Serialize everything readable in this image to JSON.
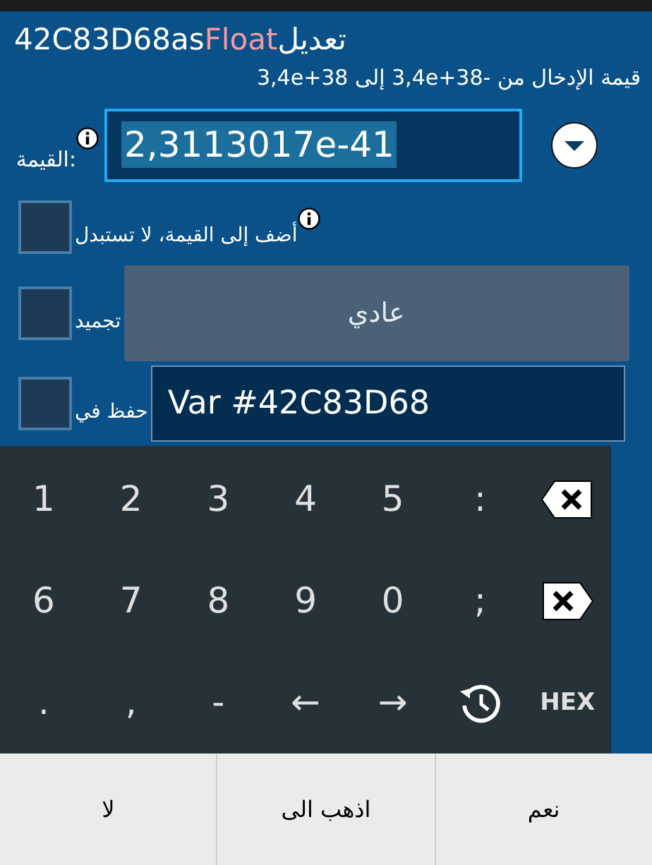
{
  "dialog": {
    "title": {
      "name": "42C83D68as",
      "type": "Float",
      "action": "تعديل"
    },
    "range": "قيمة الإدخال من -3,4e+38 إلى 3,4e+38",
    "value": {
      "label": "القيمة:",
      "text": "2,3113017e-41",
      "selected": true
    },
    "options": [
      {
        "kind": "plain",
        "label": "أضف إلى القيمة، لا تستبدل",
        "checked": false,
        "info": true
      },
      {
        "kind": "button",
        "label": "تجميد",
        "checked": false,
        "control": "عادي"
      },
      {
        "kind": "field",
        "label": "حفظ في",
        "checked": false,
        "control": "Var #42C83D68"
      }
    ]
  },
  "keyboard": [
    {
      "kind": "backspace"
    },
    {
      "kind": "text",
      "label": ":"
    },
    {
      "kind": "text",
      "label": "5"
    },
    {
      "kind": "text",
      "label": "4"
    },
    {
      "kind": "text",
      "label": "3"
    },
    {
      "kind": "text",
      "label": "2"
    },
    {
      "kind": "text",
      "label": "1"
    },
    {
      "kind": "delete"
    },
    {
      "kind": "text",
      "label": ";"
    },
    {
      "kind": "text",
      "label": "0"
    },
    {
      "kind": "text",
      "label": "9"
    },
    {
      "kind": "text",
      "label": "8"
    },
    {
      "kind": "text",
      "label": "7"
    },
    {
      "kind": "text",
      "label": "6"
    },
    {
      "kind": "bold",
      "label": "HEX"
    },
    {
      "kind": "history"
    },
    {
      "kind": "text",
      "label": "→"
    },
    {
      "kind": "text",
      "label": "←"
    },
    {
      "kind": "text",
      "label": "-"
    },
    {
      "kind": "text",
      "label": ","
    },
    {
      "kind": "text",
      "label": "."
    }
  ],
  "buttons": [
    "نعم",
    "اذهب الى",
    "لا"
  ]
}
